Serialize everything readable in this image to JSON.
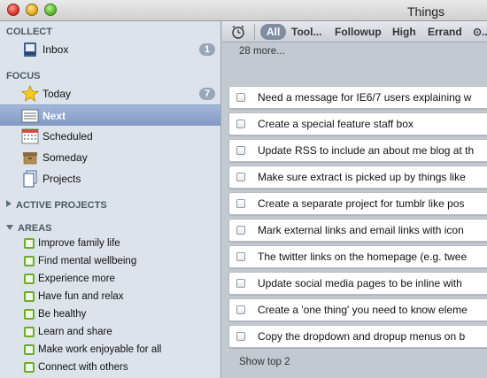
{
  "window": {
    "title": "Things"
  },
  "sidebar": {
    "collect": {
      "header": "COLLECT",
      "items": [
        {
          "label": "Inbox",
          "badge": "1",
          "icon": "inbox-tray-icon"
        }
      ]
    },
    "focus": {
      "header": "FOCUS",
      "items": [
        {
          "label": "Today",
          "badge": "7",
          "icon": "star-icon"
        },
        {
          "label": "Next",
          "icon": "list-icon",
          "selected": true
        },
        {
          "label": "Scheduled",
          "icon": "calendar-icon"
        },
        {
          "label": "Someday",
          "icon": "box-icon"
        },
        {
          "label": "Projects",
          "icon": "documents-icon"
        }
      ]
    },
    "active_projects": {
      "header": "ACTIVE PROJECTS",
      "expanded": false
    },
    "areas": {
      "header": "AREAS",
      "expanded": true,
      "items": [
        "Improve family life",
        "Find mental wellbeing",
        "Experience more",
        "Have fun and relax",
        "Be healthy",
        "Learn and share",
        "Make work enjoyable for all",
        "Connect with others"
      ]
    }
  },
  "toolbar": {
    "icon": "alarm-clock-icon",
    "tags": [
      "All",
      "Tool...",
      "Followup",
      "High",
      "Errand",
      "⊙..."
    ],
    "active_tag": "All"
  },
  "main": {
    "more_label": "28 more...",
    "todos": [
      "Need a message for IE6/7 users explaining w",
      "Create a special feature staff box",
      "Update RSS to include an about me blog at th",
      "Make sure extract is picked up by things like",
      "Create a separate project for tumblr like pos",
      "Mark external links and email links with icon",
      "The twitter links on the homepage (e.g. twee",
      "Update social media pages to be inline with",
      "Create a 'one thing' you need to know eleme",
      "Copy the dropdown and dropup menus on b"
    ],
    "show_top_label": "Show top 2"
  },
  "colors": {
    "sidebar_bg": "#dde3ea",
    "selection": "#8199c4",
    "badge": "#98a6b8",
    "area_green": "#6cab2b",
    "main_bg": "#c3c9d1"
  }
}
